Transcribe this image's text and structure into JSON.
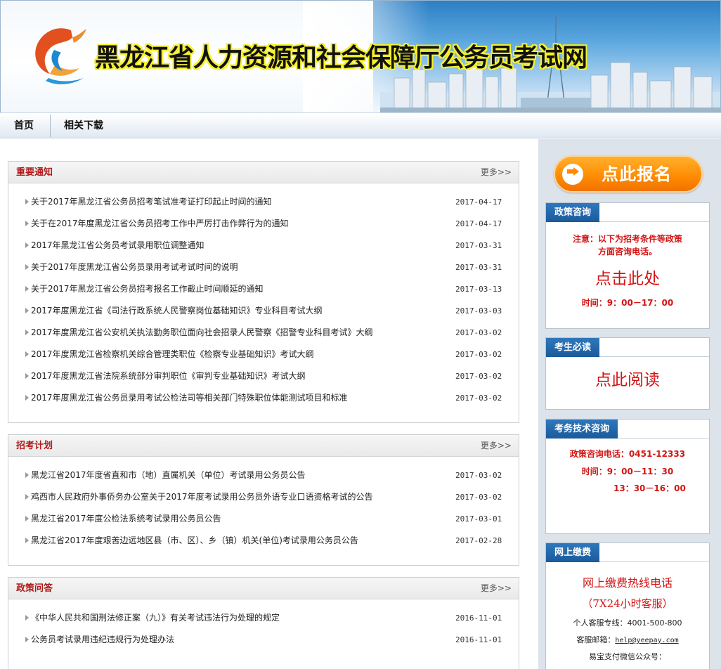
{
  "header": {
    "site_title": "黑龙江省人力资源和社会保障厅公务员考试网"
  },
  "nav": {
    "items": [
      {
        "label": "首页"
      },
      {
        "label": "相关下载"
      }
    ]
  },
  "sections": {
    "notices": {
      "title": "重要通知",
      "more": "更多>>",
      "items": [
        {
          "title": "关于2017年黑龙江省公务员招考笔试准考证打印起止时间的通知",
          "date": "2017-04-17"
        },
        {
          "title": "关于在2017年度黑龙江省公务员招考工作中严厉打击作弊行为的通知",
          "date": "2017-04-17"
        },
        {
          "title": "2017年黑龙江省公务员考试录用职位调整通知",
          "date": "2017-03-31"
        },
        {
          "title": "关于2017年度黑龙江省公务员录用考试考试时间的说明",
          "date": "2017-03-31"
        },
        {
          "title": "关于2017年黑龙江省公务员招考报名工作截止时间顺延的通知",
          "date": "2017-03-13"
        },
        {
          "title": "2017年度黑龙江省《司法行政系统人民警察岗位基础知识》专业科目考试大纲",
          "date": "2017-03-03"
        },
        {
          "title": "2017年度黑龙江省公安机关执法勤务职位面向社会招录人民警察《招警专业科目考试》大纲",
          "date": "2017-03-02"
        },
        {
          "title": "2017年度黑龙江省检察机关综合管理类职位《检察专业基础知识》考试大纲",
          "date": "2017-03-02"
        },
        {
          "title": "2017年度黑龙江省法院系统部分审判职位《审判专业基础知识》考试大纲",
          "date": "2017-03-02"
        },
        {
          "title": "2017年度黑龙江省公务员录用考试公检法司等相关部门特殊职位体能测试项目和标准",
          "date": "2017-03-02"
        }
      ]
    },
    "plans": {
      "title": "招考计划",
      "more": "更多>>",
      "items": [
        {
          "title": "黑龙江省2017年度省直和市（地）直属机关（单位）考试录用公务员公告",
          "date": "2017-03-02"
        },
        {
          "title": "鸡西市人民政府外事侨务办公室关于2017年度考试录用公务员外语专业口语资格考试的公告",
          "date": "2017-03-02"
        },
        {
          "title": "黑龙江省2017年度公检法系统考试录用公务员公告",
          "date": "2017-03-01"
        },
        {
          "title": "黑龙江省2017年度艰苦边远地区县（市、区）、乡（镇）机关(单位)考试录用公务员公告",
          "date": "2017-02-28"
        }
      ]
    },
    "qa": {
      "title": "政策问答",
      "more": "更多>>",
      "items": [
        {
          "title": "《中华人民共和国刑法修正案（九）》有关考试违法行为处理的规定",
          "date": "2016-11-01"
        },
        {
          "title": "公务员考试录用违纪违规行为处理办法",
          "date": "2016-11-01"
        }
      ]
    }
  },
  "sidebar": {
    "signup_label": "点此报名",
    "policy": {
      "title": "政策咨询",
      "note_line1": "注意：以下为招考条件等政策",
      "note_line2": "方面咨询电话。",
      "link": "点击此处",
      "hours": "时间：9：00－17：00"
    },
    "must_read": {
      "title": "考生必读",
      "link": "点此阅读"
    },
    "tech": {
      "title": "考务技术咨询",
      "phone": "政策咨询电话：0451-12333",
      "hours1": "时间：9：00－11：30",
      "hours2": "13：30－16：00"
    },
    "payment": {
      "title": "网上缴费",
      "hotline": "网上缴费热线电话",
      "service": "（7X24小时客服）",
      "personal": "个人客服专线：4001-500-800",
      "email_label": "客服邮箱：",
      "email": "help@yeepay.com",
      "wechat": "易宝支付微信公众号："
    }
  }
}
